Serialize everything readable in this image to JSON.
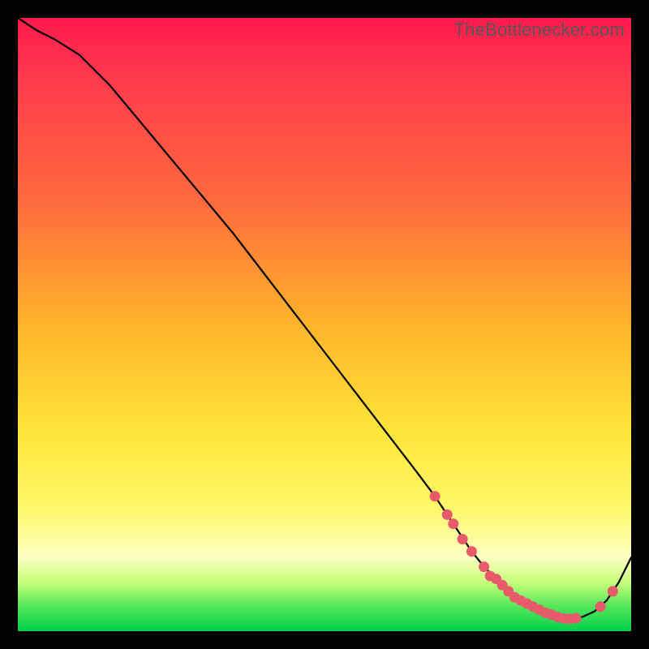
{
  "watermark": "TheBottlenecker.com",
  "colors": {
    "gradient_top": "#ff1a4d",
    "gradient_mid": "#ffe63a",
    "gradient_bottom": "#00d04a",
    "line": "#000000",
    "marker": "#e65a6a",
    "frame_bg": "#000000"
  },
  "chart_data": {
    "type": "line",
    "title": "",
    "xlabel": "",
    "ylabel": "",
    "xlim": [
      0,
      100
    ],
    "ylim": [
      0,
      100
    ],
    "x": [
      0,
      3,
      6,
      10,
      15,
      20,
      25,
      30,
      35,
      40,
      45,
      50,
      55,
      60,
      65,
      68,
      70,
      72,
      74,
      76,
      78,
      80,
      82,
      84,
      86,
      88,
      90,
      92,
      94,
      96,
      98,
      100
    ],
    "y": [
      100,
      98,
      96.5,
      94,
      89,
      83,
      77,
      71,
      65,
      58.5,
      52,
      45.5,
      39,
      32.5,
      26,
      22,
      19,
      16,
      13,
      10.5,
      8.5,
      6.5,
      5,
      4,
      3,
      2.3,
      2,
      2.3,
      3.2,
      5,
      8,
      12
    ],
    "markers": [
      {
        "x": 68,
        "y": 22
      },
      {
        "x": 70,
        "y": 19
      },
      {
        "x": 71,
        "y": 17.5
      },
      {
        "x": 72.5,
        "y": 15
      },
      {
        "x": 74,
        "y": 13
      },
      {
        "x": 76,
        "y": 10.5
      },
      {
        "x": 77,
        "y": 9
      },
      {
        "x": 78,
        "y": 8.5
      },
      {
        "x": 79,
        "y": 7.5
      },
      {
        "x": 80,
        "y": 6.5
      },
      {
        "x": 81,
        "y": 5.5
      },
      {
        "x": 82,
        "y": 5
      },
      {
        "x": 83,
        "y": 4.5
      },
      {
        "x": 84,
        "y": 4
      },
      {
        "x": 85,
        "y": 3.5
      },
      {
        "x": 86,
        "y": 3
      },
      {
        "x": 87,
        "y": 2.7
      },
      {
        "x": 88,
        "y": 2.3
      },
      {
        "x": 89,
        "y": 2.1
      },
      {
        "x": 90,
        "y": 2
      },
      {
        "x": 91,
        "y": 2.1
      },
      {
        "x": 95,
        "y": 4
      },
      {
        "x": 97,
        "y": 6.5
      }
    ]
  }
}
